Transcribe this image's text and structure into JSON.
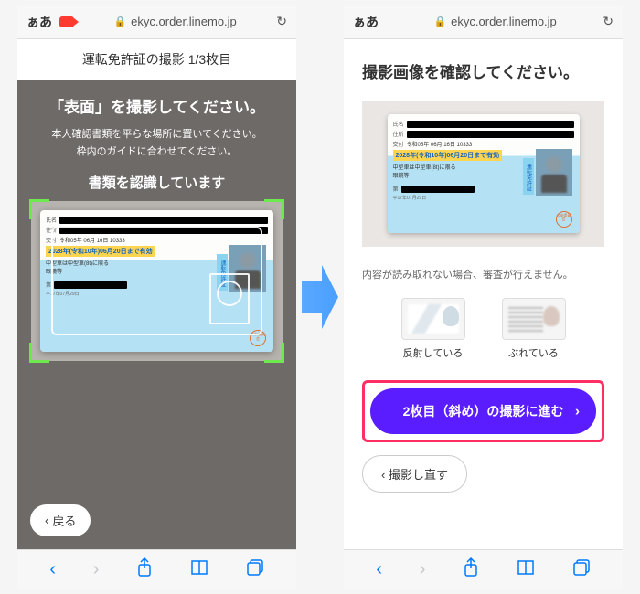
{
  "browser": {
    "aa_label": "ぁあ",
    "url": "ekyc.order.linemo.jp"
  },
  "left": {
    "header": "運転免許証の撮影  1/3枚目",
    "title": "「表面」を撮影してください。",
    "sub1": "本人確認書類を平らな場所に置いてください。",
    "sub2": "枠内のガイドに合わせてください。",
    "recognizing": "書類を認識しています",
    "back": "戻る"
  },
  "card": {
    "name_label": "氏名",
    "addr_label": "住所",
    "deliv_label": "交付",
    "deliv_val": "令和05年 06月 16日  10333",
    "expiry": "2028年(令和10年)06月20日まで有効",
    "cond1": "中型車は中型車(8t)に限る",
    "cond_label": "眼鏡等",
    "num_label": "第",
    "vert": "運転免許証",
    "small1": "平17年07月29日",
    "stamp": "公安委員会"
  },
  "right": {
    "title": "撮影画像を確認してください。",
    "warn": "内容が読み取れない場合、審査が行えません。",
    "example1": "反射している",
    "example2": "ぶれている",
    "primary": "2枚目（斜め）の撮影に進む",
    "secondary": "撮影し直す"
  }
}
